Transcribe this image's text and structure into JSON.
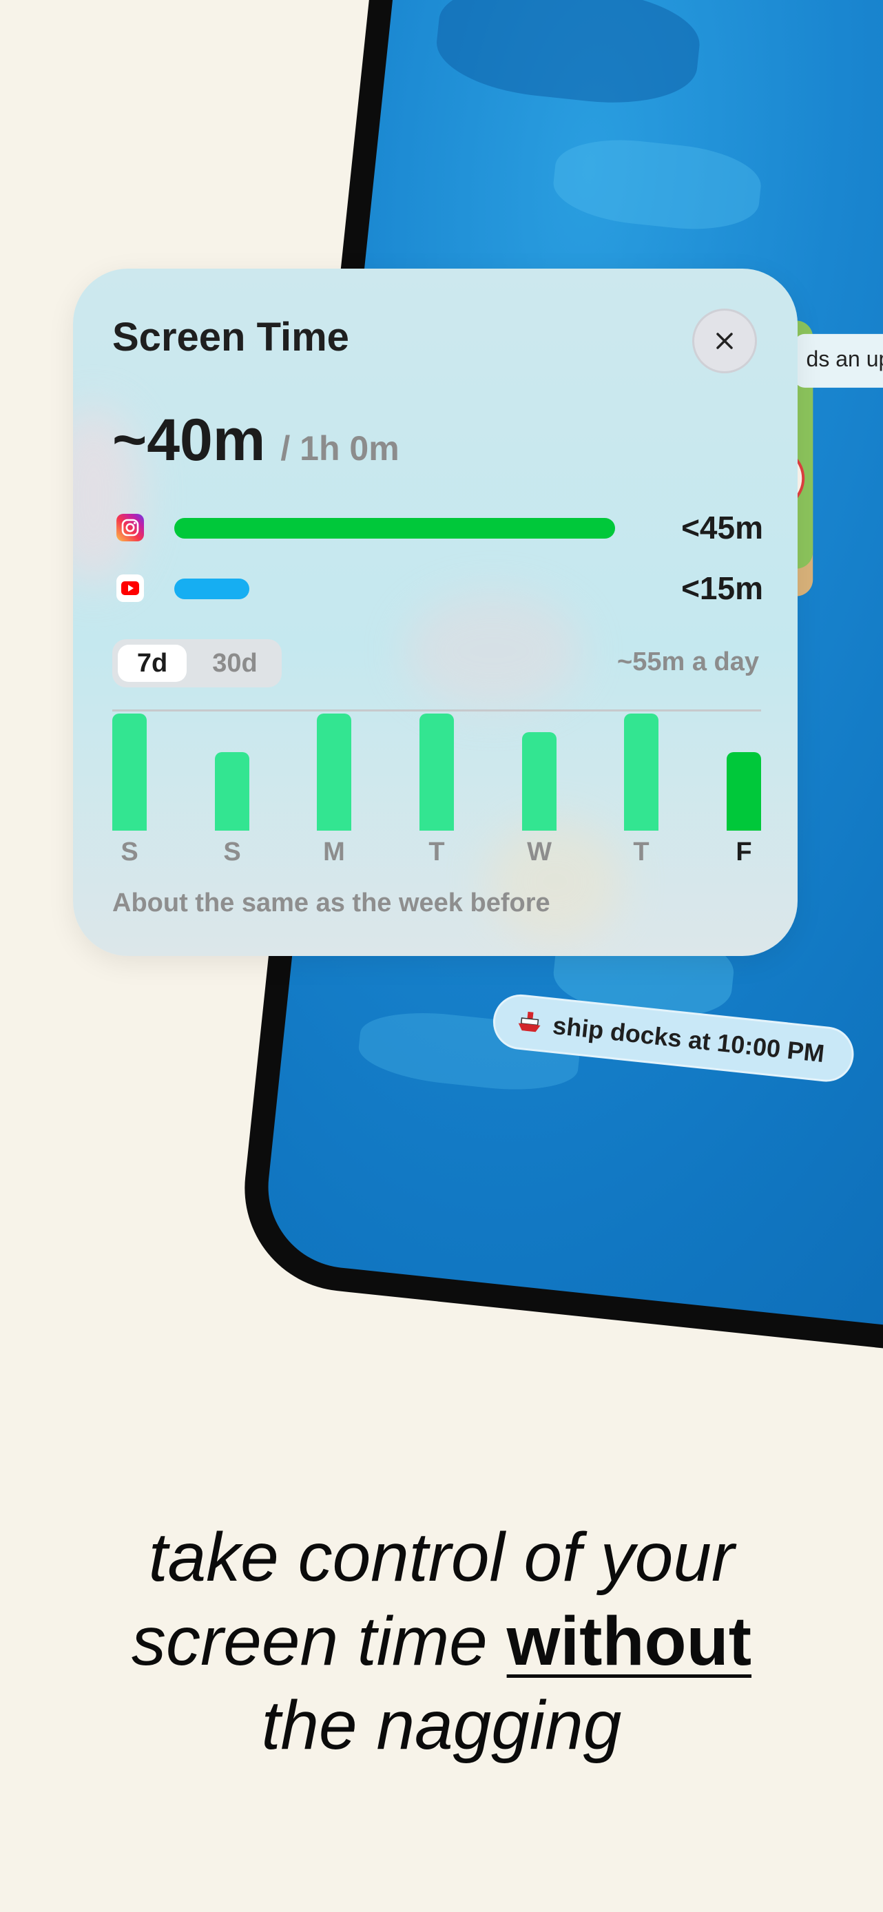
{
  "phone": {
    "speech_bubble": "ds an up",
    "ship_pill": {
      "icon": "ship-icon",
      "text": "ship docks at 10:00 PM"
    },
    "strawberry_icon": "🍓"
  },
  "screen_time_card": {
    "title": "Screen Time",
    "close_icon": "close-icon",
    "total_used": "~40m",
    "limit": "/ 1h 0m",
    "apps": [
      {
        "name": "instagram",
        "icon": "instagram-icon",
        "time": "<45m",
        "fill": 1.0,
        "color": "#00c83a"
      },
      {
        "name": "youtube",
        "icon": "youtube-icon",
        "time": "<15m",
        "fill": 0.17,
        "color": "#16aef2"
      }
    ],
    "range_tabs": [
      "7d",
      "30d"
    ],
    "selected_range": "7d",
    "daily_average": "~55m a day",
    "footnote": "About the same as the week before",
    "colors": {
      "bar": "#33e591",
      "today_bar": "#00c83a"
    }
  },
  "chart_data": {
    "type": "bar",
    "categories": [
      "S",
      "S",
      "M",
      "T",
      "W",
      "T",
      "F"
    ],
    "values": [
      1.0,
      0.67,
      1.0,
      1.0,
      0.84,
      1.0,
      0.67
    ],
    "highlighted_category_index": 6,
    "grid": false
  },
  "tagline": {
    "line1": "take control of your",
    "line2_prefix": "screen time",
    "line2_emphasis": "without",
    "line3": "the nagging"
  }
}
